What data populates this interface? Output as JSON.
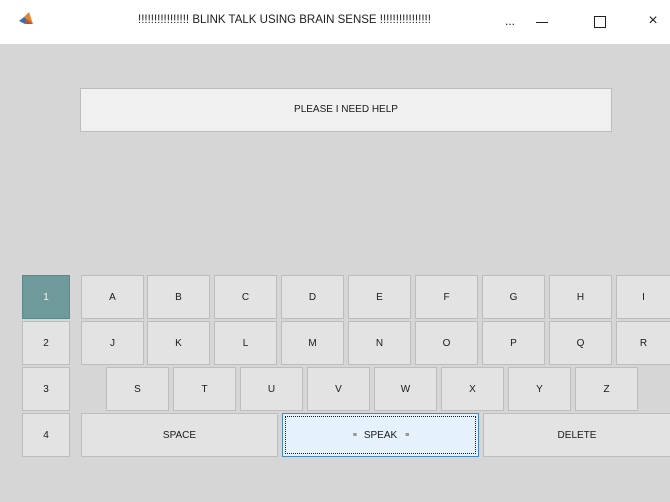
{
  "window": {
    "title": "!!!!!!!!!!!!!!!! BLINK TALK USING BRAIN SENSE !!!!!!!!!!!!!!!!",
    "icon": "matlab-icon",
    "controls": {
      "more": "...",
      "minimize": "minimize-icon",
      "maximize": "maximize-icon",
      "close": "×"
    }
  },
  "message": {
    "text": "PLEASE I NEED HELP"
  },
  "rows": {
    "r1": "1",
    "r2": "2",
    "r3": "3",
    "r4": "4",
    "active_row": "1"
  },
  "keyboard": {
    "row1": [
      "A",
      "B",
      "C",
      "D",
      "E",
      "F",
      "G",
      "H",
      "I"
    ],
    "row2": [
      "J",
      "K",
      "L",
      "M",
      "N",
      "O",
      "P",
      "Q",
      "R"
    ],
    "row3": [
      "S",
      "T",
      "U",
      "V",
      "W",
      "X",
      "Y",
      "Z"
    ],
    "row4": {
      "space": "SPACE",
      "speak": "SPEAK",
      "speak_mark": "≡",
      "delete": "DELETE"
    }
  },
  "colors": {
    "background": "#d6d6d6",
    "button": "#e3e3e3",
    "active_row": "#6f9a9b",
    "speak_focus": "#e5f1fb"
  }
}
